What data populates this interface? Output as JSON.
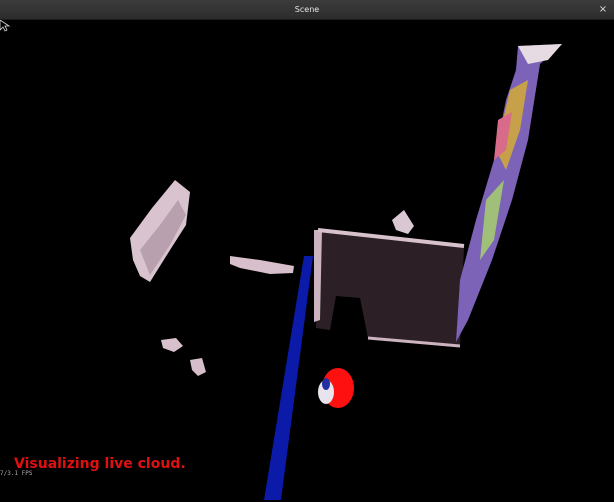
{
  "window": {
    "title": "Scene",
    "close_glyph": "×"
  },
  "viewport": {
    "status_text": "Visualizing live cloud.",
    "fps_text": "7/3.1 FPS"
  },
  "colors": {
    "status": "#e01010",
    "axis": "#0b1aa8",
    "highlight_cluster": "#ff1010",
    "background": "#000000"
  }
}
